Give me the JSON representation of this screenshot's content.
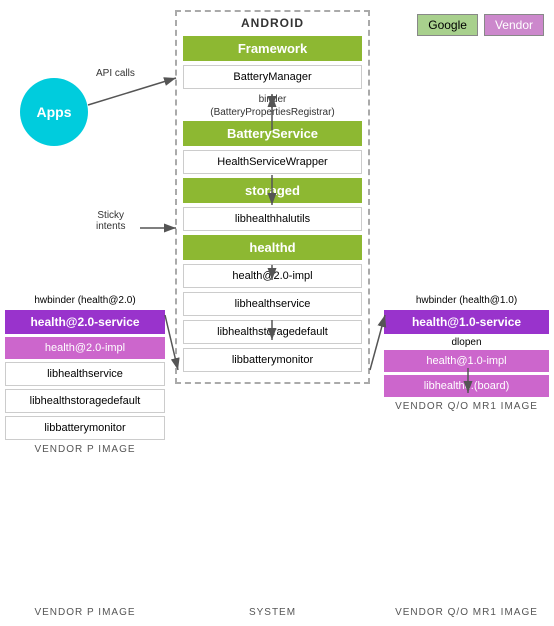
{
  "top_labels": {
    "google": "Google",
    "vendor": "Vendor"
  },
  "android_column": {
    "title": "ANDROID",
    "framework": "Framework",
    "batteryManager": "BatteryManager",
    "binderLabel": "binder\n(BatteryPropertiesRegistrar)",
    "batteryService": "BatteryService",
    "healthServiceWrapper": "HealthServiceWrapper",
    "storaged": "storaged",
    "libhealthhalutils": "libhealthhalutils",
    "healthd": "healthd",
    "healthd_health_impl": "health@2.0-impl",
    "healthd_libhealthservice": "libhealthservice",
    "healthd_libstoragedefault": "libhealthstoragedefault",
    "healthd_libbatterymonitor": "libbatterymonitor"
  },
  "apps": {
    "label": "Apps"
  },
  "annotations": {
    "api_calls": "API\ncalls",
    "sticky_intents": "Sticky\nintents",
    "hwbinder_20_left": "hwbinder (health@2.0)",
    "hwbinder_10_right": "hwbinder (health@1.0)",
    "dlopen": "dlopen"
  },
  "vendor_p": {
    "title": "VENDOR P IMAGE",
    "service": "health@2.0-service",
    "impl": "health@2.0-impl",
    "libhealthservice": "libhealthservice",
    "libstoragedefault": "libhealthstoragedefault",
    "libbatterymonitor": "libbatterymonitor"
  },
  "vendor_q": {
    "title": "VENDOR Q/O MR1 IMAGE",
    "service": "health@1.0-service",
    "impl": "health@1.0-impl",
    "libhealthd_board": "libhealthd.(board)"
  }
}
